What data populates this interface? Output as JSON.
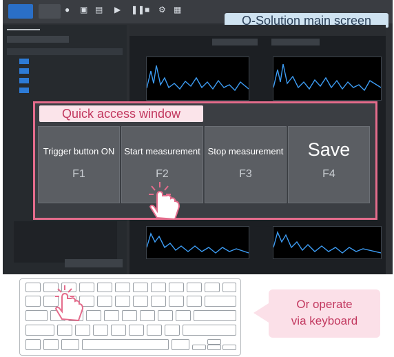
{
  "callouts": {
    "main_screen": "O-Solution main screen",
    "quick_access": "Quick access window",
    "keyboard": [
      "Or operate",
      "via keyboard"
    ]
  },
  "quick_access_buttons": [
    {
      "label": "Trigger button ON",
      "key": "F1"
    },
    {
      "label": "Start measurement",
      "key": "F2"
    },
    {
      "label": "Stop measurement",
      "key": "F3"
    },
    {
      "label": "Save",
      "key": "F4"
    }
  ],
  "colors": {
    "accent_pink": "#e46c8c",
    "callout_blue_bg": "#cfe3f1",
    "trace_blue": "#3d9df5"
  },
  "icons": [
    "record-icon",
    "monitor-icon",
    "play-icon",
    "pause-icon",
    "stop-icon",
    "hand-cursor-icon"
  ]
}
